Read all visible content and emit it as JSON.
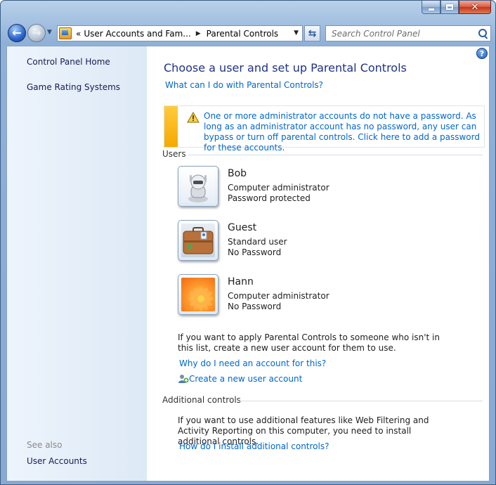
{
  "window": {
    "caption_buttons": [
      "minimize",
      "maximize",
      "close"
    ]
  },
  "navigation": {
    "address_segments": [
      "User Accounts and Fam...",
      "Parental Controls"
    ],
    "address_overflow": "«",
    "search_placeholder": "Search Control Panel"
  },
  "sidebar": {
    "links": [
      {
        "label": "Control Panel Home"
      },
      {
        "label": "Game Rating Systems"
      }
    ],
    "see_also_heading": "See also",
    "see_also_links": [
      {
        "label": "User Accounts"
      }
    ]
  },
  "main": {
    "title": "Choose a user and set up Parental Controls",
    "help_link": "What can I do with Parental Controls?",
    "warning": "One or more administrator accounts do not have a password. As long as an administrator account has no password, any user can bypass or turn off parental controls. Click here to add a password for these accounts.",
    "users_heading": "Users",
    "users": [
      {
        "name": "Bob",
        "role": "Computer administrator",
        "status": "Password protected",
        "picture": "robot-picture"
      },
      {
        "name": "Guest",
        "role": "Standard user",
        "status": "No Password",
        "picture": "briefcase-picture"
      },
      {
        "name": "Hann",
        "role": "Computer administrator",
        "status": "No Password",
        "picture": "flower-picture"
      }
    ],
    "new_account_text": "If you want to apply Parental Controls to someone who isn't in this list, create a new user account for them to use.",
    "why_account_link": "Why do I need an account for this?",
    "create_account_link": "Create a new user account",
    "additional_heading": "Additional controls",
    "additional_text": "If you want to use additional features like Web Filtering and Activity Reporting on this computer, you need to install additional controls.",
    "install_link": "How do I install additional controls?"
  },
  "colors": {
    "link": "#0066cc",
    "title": "#1e3287",
    "warning_bar": "#f6a800"
  }
}
